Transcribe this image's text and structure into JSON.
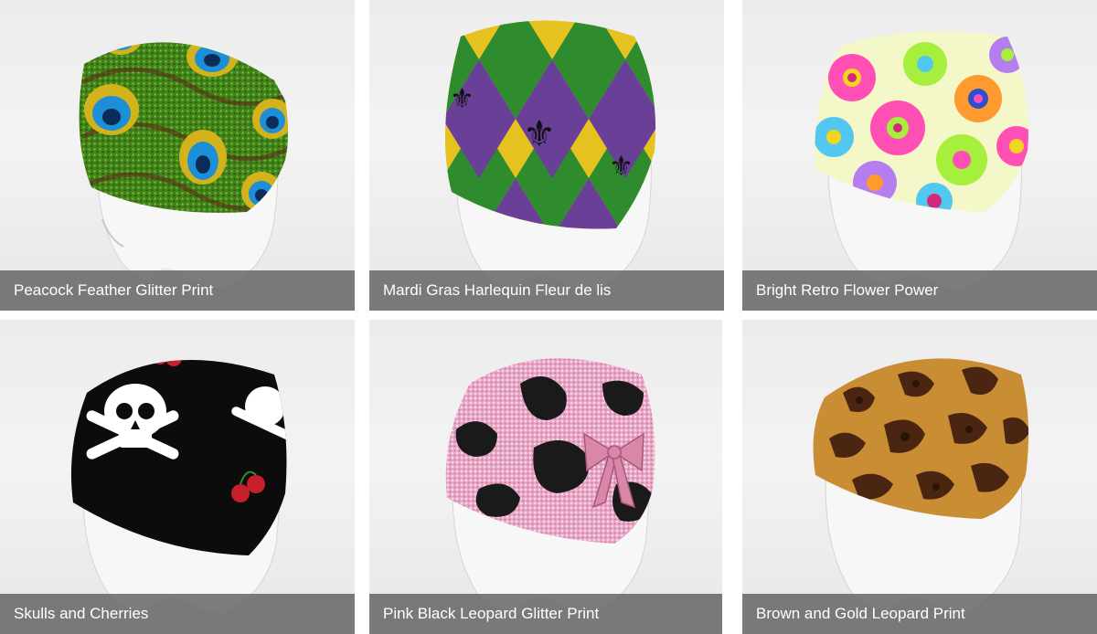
{
  "products": [
    {
      "title": "Peacock Feather Glitter Print",
      "pattern": "peacock-feather-glitter",
      "colors": {
        "base": "#3f8a1c",
        "accent": "#1d8fd6",
        "ring": "#d4b21c"
      }
    },
    {
      "title": "Mardi Gras Harlequin Fleur de lis",
      "pattern": "harlequin-fleur-de-lis",
      "colors": {
        "purple": "#6a3f97",
        "green": "#2f8c2e",
        "yellow": "#e5c21f"
      }
    },
    {
      "title": "Bright Retro Flower Power",
      "pattern": "retro-flowers",
      "colors": {
        "pink": "#ff4fb5",
        "lime": "#a6ef3c",
        "blue": "#52c7f0"
      }
    },
    {
      "title": "Skulls and Cherries",
      "pattern": "skulls-and-cherries",
      "colors": {
        "base": "#0c0c0c",
        "skull": "#ffffff",
        "cherry": "#c8202a"
      }
    },
    {
      "title": "Pink Black Leopard Glitter Print",
      "pattern": "pink-black-leopard-glitter",
      "colors": {
        "pink": "#e8a8c8",
        "black": "#1a1a1a",
        "bow": "#d987a8"
      }
    },
    {
      "title": "Brown and Gold Leopard Print",
      "pattern": "brown-gold-leopard",
      "colors": {
        "gold": "#c98d34",
        "brown": "#4a2612"
      }
    }
  ]
}
